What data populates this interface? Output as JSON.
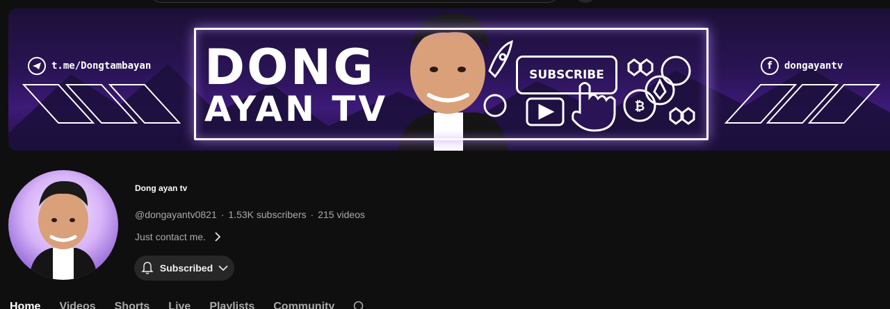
{
  "banner": {
    "telegram_handle": "t.me/Dongtambayan",
    "facebook_handle": "dongayantv",
    "brand_line1": "DONG",
    "brand_line2": "AYAN TV",
    "subscribe_text": "SUBSCRIBE"
  },
  "channel": {
    "name": "Dong ayan tv",
    "handle": "@dongayantv0821",
    "separator": "·",
    "subscribers": "1.53K subscribers",
    "videos": "215 videos",
    "description": "Just contact me."
  },
  "subscribe_button": {
    "label": "Subscribed"
  },
  "tabs": [
    {
      "label": "Home",
      "active": true
    },
    {
      "label": "Videos"
    },
    {
      "label": "Shorts"
    },
    {
      "label": "Live"
    },
    {
      "label": "Playlists"
    },
    {
      "label": "Community"
    }
  ],
  "colors": {
    "background": "#0f0f0f",
    "banner_purple": "#3d1a78",
    "secondary_text": "#aaaaaa",
    "button_bg": "#272727"
  },
  "icons": [
    "telegram-icon",
    "facebook-icon",
    "rocket-icon",
    "play-icon",
    "hand-cursor-icon",
    "bitcoin-icon",
    "ethereum-icon",
    "bell-icon",
    "chevron-down-icon",
    "chevron-right-icon",
    "search-icon"
  ]
}
